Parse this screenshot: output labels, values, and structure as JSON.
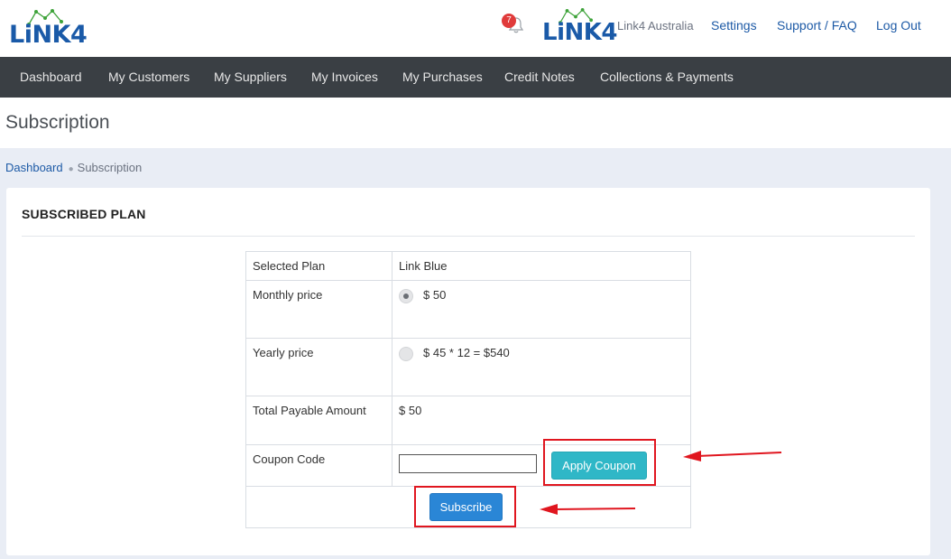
{
  "brand": {
    "logo_text": "LiNK4",
    "company_logo_text": "LiNK4",
    "company_name": "Link4 Australia",
    "brand_color": "#1a5aa8",
    "logo_accent_color": "#3ea33a"
  },
  "notifications": {
    "count": "7",
    "icon": "bell-icon"
  },
  "top_links": {
    "settings": "Settings",
    "support": "Support / FAQ",
    "logout": "Log Out"
  },
  "nav": {
    "items": [
      {
        "label": "Dashboard"
      },
      {
        "label": "My Customers"
      },
      {
        "label": "My Suppliers"
      },
      {
        "label": "My Invoices"
      },
      {
        "label": "My Purchases"
      },
      {
        "label": "Credit Notes"
      },
      {
        "label": "Collections & Payments"
      }
    ]
  },
  "page": {
    "title": "Subscription",
    "breadcrumb": {
      "home": "Dashboard",
      "current": "Subscription"
    }
  },
  "plan": {
    "heading": "SUBSCRIBED PLAN",
    "selected_plan_label": "Selected Plan",
    "selected_plan_value": "Link Blue",
    "monthly_label": "Monthly price",
    "monthly_value": "$ 50",
    "monthly_selected": true,
    "yearly_label": "Yearly price",
    "yearly_value": "$ 45 * 12 = $540",
    "yearly_selected": false,
    "total_label": "Total Payable Amount",
    "total_value": "$ 50",
    "coupon_label": "Coupon Code",
    "coupon_value": "",
    "apply_coupon_label": "Apply Coupon",
    "subscribe_label": "Subscribe"
  },
  "colors": {
    "navbar": "#3a3f44",
    "apply_button": "#2fb7c7",
    "subscribe_button": "#2a86d6",
    "annotation": "#e0161f",
    "badge": "#e03a3a"
  }
}
